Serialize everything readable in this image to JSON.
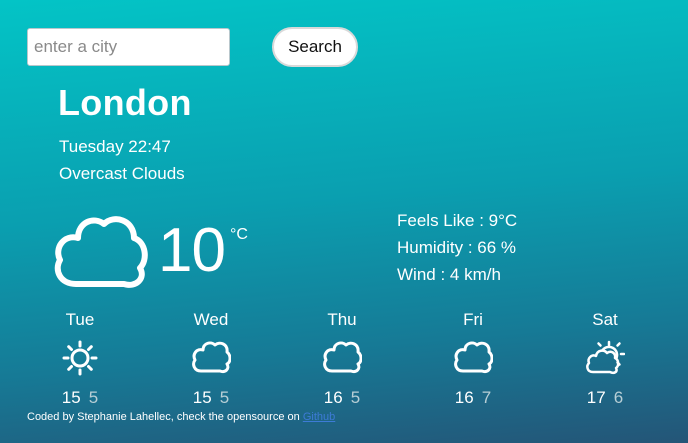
{
  "search": {
    "placeholder": "enter a city",
    "value": "",
    "button_label": "Search"
  },
  "current": {
    "city": "London",
    "datetime": "Tuesday 22:47",
    "description": "Overcast Clouds",
    "icon": "cloud-icon",
    "temperature": "10",
    "unit": "°C",
    "feels_like": "Feels Like : 9°C",
    "humidity": "Humidity : 66 %",
    "wind": "Wind : 4 km/h"
  },
  "forecast": [
    {
      "day": "Tue",
      "icon": "sun-icon",
      "max": "15",
      "min": "5"
    },
    {
      "day": "Wed",
      "icon": "cloud-icon",
      "max": "15",
      "min": "5"
    },
    {
      "day": "Thu",
      "icon": "cloud-icon",
      "max": "16",
      "min": "5"
    },
    {
      "day": "Fri",
      "icon": "cloud-icon",
      "max": "16",
      "min": "7"
    },
    {
      "day": "Sat",
      "icon": "partly-cloudy-icon",
      "max": "17",
      "min": "6"
    }
  ],
  "footer": {
    "text": "Coded by Stephanie Lahellec, check the opensource on ",
    "link_label": "Github"
  },
  "colors": {
    "gradient_top": "#03c4c6",
    "gradient_bottom": "#245577",
    "link": "#3d7bd6"
  }
}
